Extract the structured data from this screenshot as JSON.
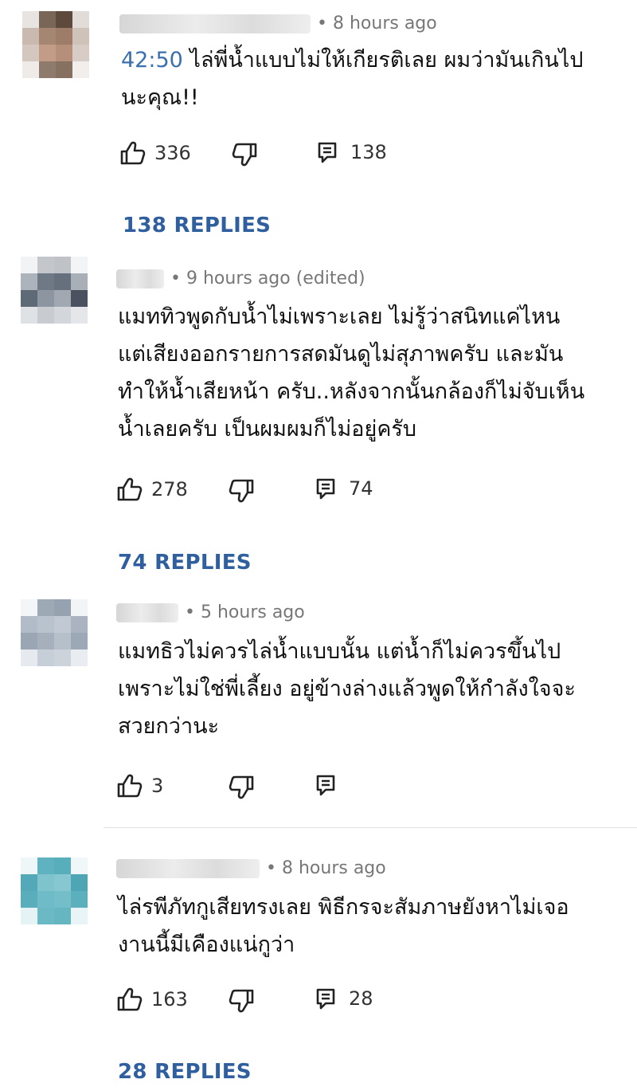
{
  "comments": [
    {
      "meta": "8 hours ago",
      "timestamp_link": "42:50",
      "text_first": " ไล่พี่น้ำแบบไม่ให้เกียรติเลย ผมว่ามันเกินไป",
      "text_second": "นะคุณ!!",
      "likes": "336",
      "reply_count": "138",
      "replies_label": "138 REPLIES"
    },
    {
      "meta": "9 hours ago (edited)",
      "lines": [
        "แมททิวพูดกับน้ำไม่เพราะเลย ไม่รู้ว่าสนิทแค่ไหน",
        "แต่เสียงออกรายการสดมันดูไม่สุภาพครับ และมัน",
        "ทำให้น้ำเสียหน้า ครับ..หลังจากนั้นกล้องก็ไม่จับเห็น",
        "น้ำเลยครับ  เป็นผมผมก็ไม่อยู่ครับ"
      ],
      "likes": "278",
      "reply_count": "74",
      "replies_label": "74 REPLIES"
    },
    {
      "meta": "5 hours ago",
      "lines": [
        "แมทธิวไม่ควรไล่น้ำแบบนั้น แต่น้ำก็ไม่ควรขึ้นไป",
        "เพราะไม่ใช่พี่เลี้ยง อยู่ข้างล่างแล้วพูดให้กำลังใจจะ",
        "สวยกว่านะ"
      ],
      "likes": "3"
    },
    {
      "meta": "8 hours ago",
      "lines": [
        "ไล่รพีภัทกูเสียทรงเลย พิธีกรจะสัมภาษยังหาไม่เจอ",
        "งานนี้มีเคืองแน่กูว่า"
      ],
      "likes": "163",
      "reply_count": "28",
      "replies_label": "28 REPLIES"
    }
  ],
  "icons": [
    "thumbs-up-icon",
    "thumbs-down-icon",
    "reply-icon"
  ],
  "colors": {
    "replies_link": "#2f5f9e",
    "timestamp_link": "#3a6fb0",
    "meta": "#777777"
  }
}
